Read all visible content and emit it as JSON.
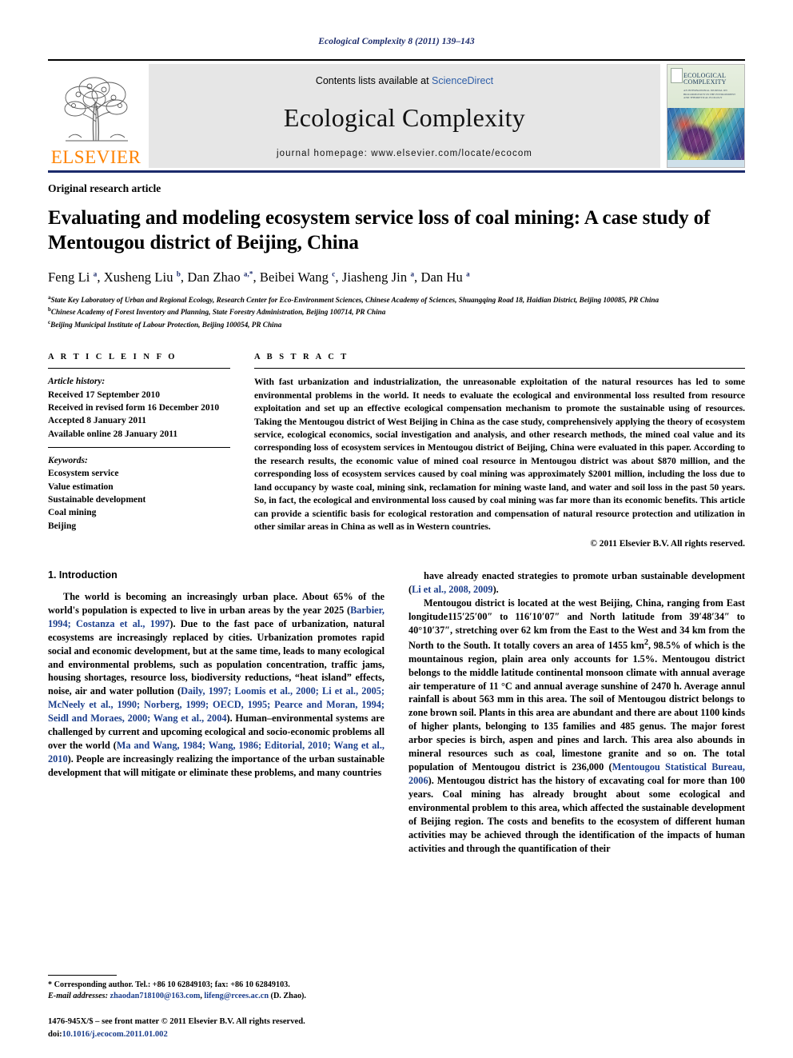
{
  "running_head": "Ecological Complexity 8 (2011) 139–143",
  "masthead": {
    "contents_prefix": "Contents lists available at ",
    "sciencedirect": "ScienceDirect",
    "journal_name": "Ecological Complexity",
    "homepage": "journal homepage: www.elsevier.com/locate/ecocom",
    "publisher": "ELSEVIER",
    "cover_title": "ECOLOGICAL COMPLEXITY",
    "cover_subtitle": "AN INTERNATIONAL JOURNAL ON BIOCOMPLEXITY IN THE ENVIRONMENT AND THEORETICAL ECOLOGY"
  },
  "article": {
    "type": "Original research article",
    "title": "Evaluating and modeling ecosystem service loss of coal mining: A case study of Mentougou district of Beijing, China",
    "authors_html": "Feng Li <sup>a</sup>, Xusheng Liu <sup>b</sup>, Dan Zhao <sup>a,*</sup>, Beibei Wang <sup>c</sup>, Jiasheng Jin <sup>a</sup>, Dan Hu <sup>a</sup>",
    "affiliations": [
      "State Key Laboratory of Urban and Regional Ecology, Research Center for Eco-Environment Sciences, Chinese Academy of Sciences, Shuangqing Road 18, Haidian District, Beijing 100085, PR China",
      "Chinese Academy of Forest Inventory and Planning, State Forestry Administration, Beijing 100714, PR China",
      "Beijing Municipal Institute of Labour Protection, Beijing 100054, PR China"
    ]
  },
  "info": {
    "label": "A R T I C L E   I N F O",
    "history_title": "Article history:",
    "history": [
      "Received 17 September 2010",
      "Received in revised form 16 December 2010",
      "Accepted 8 January 2011",
      "Available online 28 January 2011"
    ],
    "keywords_title": "Keywords:",
    "keywords": [
      "Ecosystem service",
      "Value estimation",
      "Sustainable development",
      "Coal mining",
      "Beijing"
    ]
  },
  "abstract": {
    "label": "A B S T R A C T",
    "text": "With fast urbanization and industrialization, the unreasonable exploitation of the natural resources has led to some environmental problems in the world. It needs to evaluate the ecological and environmental loss resulted from resource exploitation and set up an effective ecological compensation mechanism to promote the sustainable using of resources. Taking the Mentougou district of West Beijing in China as the case study, comprehensively applying the theory of ecosystem service, ecological economics, social investigation and analysis, and other research methods, the mined coal value and its corresponding loss of ecosystem services in Mentougou district of Beijing, China were evaluated in this paper. According to the research results, the economic value of mined coal resource in Mentougou district was about $870 million, and the corresponding loss of ecosystem services caused by coal mining was approximately $2001 million, including the loss due to land occupancy by waste coal, mining sink, reclamation for mining waste land, and water and soil loss in the past 50 years. So, in fact, the ecological and environmental loss caused by coal mining was far more than its economic benefits. This article can provide a scientific basis for ecological restoration and compensation of natural resource protection and utilization in other similar areas in China as well as in Western countries.",
    "copyright": "© 2011 Elsevier B.V. All rights reserved."
  },
  "body": {
    "section_heading": "1. Introduction",
    "left_para_1_html": "The world is becoming an increasingly urban place. About 65% of the world's population is expected to live in urban areas by the year 2025 (<span class=\"cite\">Barbier, 1994; Costanza et al., 1997</span>). Due to the fast pace of urbanization, natural ecosystems are increasingly replaced by cities. Urbanization promotes rapid social and economic development, but at the same time, leads to many ecological and environmental problems, such as population concentration, traffic jams, housing shortages, resource loss, biodiversity reductions, &ldquo;heat island&rdquo; effects, noise, air and water pollution (<span class=\"cite\">Daily, 1997; Loomis et al., 2000; Li et al., 2005; McNeely et al., 1990; Norberg, 1999; OECD, 1995; Pearce and Moran, 1994; Seidl and Moraes, 2000; Wang et al., 2004</span>). Human&ndash;environmental systems are challenged by current and upcoming ecological and socio-economic problems all over the world (<span class=\"cite\">Ma and Wang, 1984; Wang, 1986; Editorial, 2010; Wang et al., 2010</span>). People are increasingly realizing the importance of the urban sustainable development that will mitigate or eliminate these problems, and many countries",
    "right_para_1_html": "have already enacted strategies to promote urban sustainable development (<span class=\"cite\">Li et al., 2008, 2009</span>).",
    "right_para_2_html": "Mentougou district is located at the west Beijing, China, ranging from East longitude115&prime;25&prime;00&Prime; to 116&prime;10&prime;07&Prime; and North latitude from 39&prime;48&prime;34&Prime; to 40&deg;10&prime;37&Prime;, stretching over 62 km from the East to the West and 34 km from the North to the South. It totally covers an area of 1455 km<sup>2</sup>, 98.5% of which is the mountainous region, plain area only accounts for 1.5%. Mentougou district belongs to the middle latitude continental monsoon climate with annual average air temperature of 11 &deg;C and annual average sunshine of 2470 h. Average annul rainfall is about 563 mm in this area. The soil of Mentougou district belongs to zone brown soil. Plants in this area are abundant and there are about 1100 kinds of higher plants, belonging to 135 families and 485 genus. The major forest arbor species is birch, aspen and pines and larch. This area also abounds in mineral resources such as coal, limestone granite and so on. The total population of Mentougou district is 236,000 (<span class=\"cite\">Mentougou Statistical Bureau, 2006</span>). Mentougou district has the history of excavating coal for more than 100 years. Coal mining has already brought about some ecological and environmental problem to this area, which affected the sustainable development of Beijing region. The costs and benefits to the ecosystem of different human activities may be achieved through the identification of the impacts of human activities and through the quantification of their"
  },
  "footnotes": {
    "corresponding_html": "* Corresponding author. Tel.: +86 10 62849103; fax: +86 10 62849103.",
    "email_html": "<span class=\"it\">E-mail addresses:</span> <a href=\"#\">zhaodan718100@163.com</a>, <a href=\"#\">lifeng@rcees.ac.cn</a> (D. Zhao).",
    "imprint_html": "1476-945X/$ &ndash; see front matter &copy; 2011 Elsevier B.V. All rights reserved.",
    "doi_html": "doi:<span class=\"doi\">10.1016/j.ecocom.2011.01.002</span>"
  }
}
